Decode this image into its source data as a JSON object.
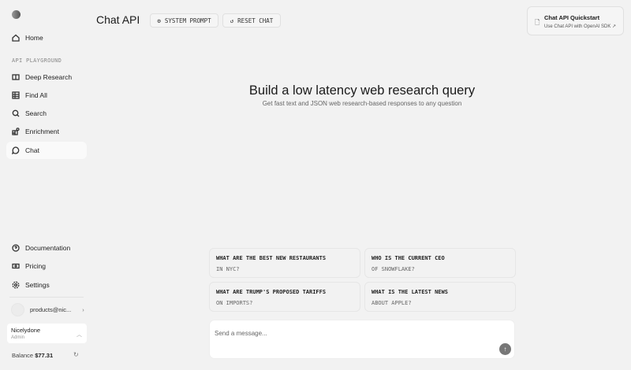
{
  "sidebar": {
    "home": "Home",
    "section": "API PLAYGROUND",
    "items": [
      {
        "label": "Deep Research"
      },
      {
        "label": "Find All"
      },
      {
        "label": "Search"
      },
      {
        "label": "Enrichment"
      },
      {
        "label": "Chat"
      }
    ],
    "bottom": [
      {
        "label": "Documentation"
      },
      {
        "label": "Pricing"
      },
      {
        "label": "Settings"
      }
    ],
    "account": "products@nic...",
    "org": {
      "name": "Nicelydone",
      "role": "Admin"
    },
    "balance_label": "Balance",
    "balance": "$77.31"
  },
  "header": {
    "title": "Chat API",
    "system_prompt": "SYSTEM PROMPT",
    "reset_chat": "RESET CHAT",
    "quickstart": {
      "title": "Chat API Quickstart",
      "subtitle": "Use Chat API with OpenAI SDK"
    }
  },
  "main": {
    "heading": "Build a low latency web research query",
    "subheading": "Get fast text and JSON web research-based responses to any question",
    "suggestions": [
      {
        "a": "WHAT ARE THE BEST NEW RESTAURANTS",
        "b": "IN NYC?"
      },
      {
        "a": "WHO IS THE CURRENT CEO",
        "b": "OF SNOWFLAKE?"
      },
      {
        "a": "WHAT ARE TRUMP'S PROPOSED TARIFFS",
        "b": "ON IMPORTS?"
      },
      {
        "a": "WHAT IS THE LATEST NEWS",
        "b": "ABOUT APPLE?"
      }
    ],
    "placeholder": "Send a message..."
  }
}
